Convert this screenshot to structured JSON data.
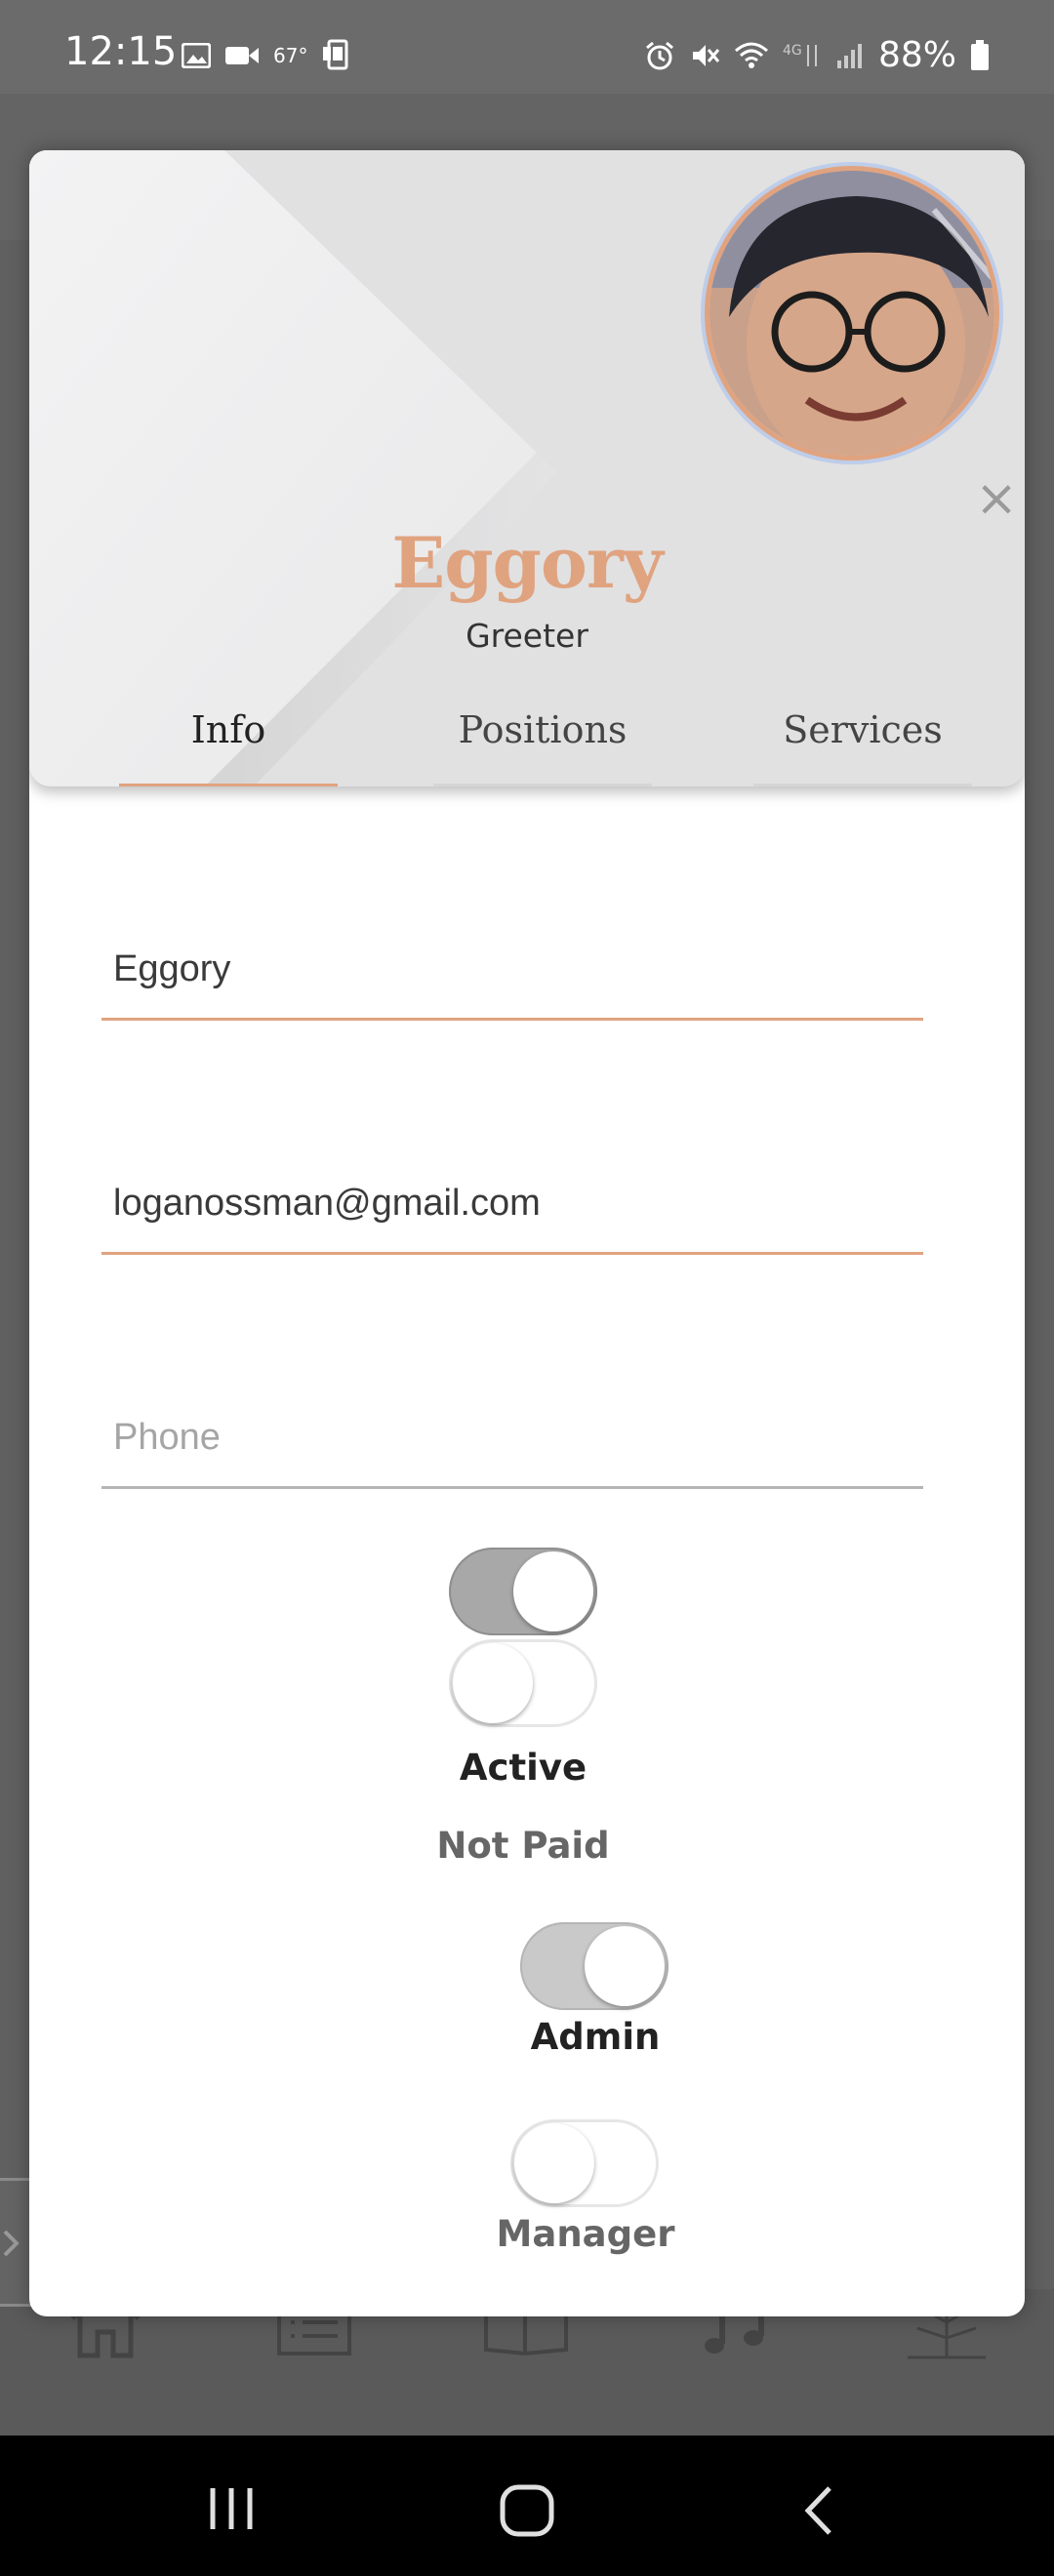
{
  "status_bar": {
    "time": "12:15",
    "temperature": "67°",
    "battery": "88%",
    "icons_left": [
      "gallery-icon",
      "video-icon",
      "weather-icon",
      "tablet-icon"
    ],
    "icons_right": [
      "alarm-icon",
      "mute-icon",
      "wifi-icon",
      "lte-icon",
      "signal-icon",
      "battery-icon"
    ]
  },
  "profile": {
    "name": "Eggory",
    "role": "Greeter",
    "accent_color": "#e0a37f"
  },
  "tabs": [
    {
      "label": "Info",
      "active": true
    },
    {
      "label": "Positions",
      "active": false
    },
    {
      "label": "Services",
      "active": false
    }
  ],
  "form": {
    "name_value": "Eggory",
    "email_value": "loganossman@gmail.com",
    "phone_placeholder": "Phone"
  },
  "toggles": {
    "active": {
      "label": "Active",
      "on": true
    },
    "paid": {
      "label": "Not Paid",
      "on": false
    },
    "admin": {
      "label": "Admin",
      "on": true
    },
    "manager": {
      "label": "Manager",
      "on": false
    }
  },
  "background_nav": [
    "home-icon",
    "list-icon",
    "book-icon",
    "music-icon",
    "tree-icon"
  ],
  "system_nav": [
    "recents-icon",
    "home-button-icon",
    "back-icon"
  ]
}
